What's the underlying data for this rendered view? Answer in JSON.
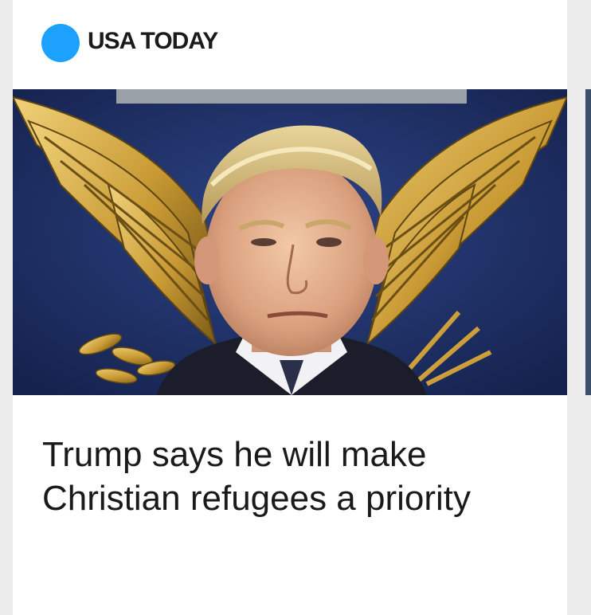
{
  "publisher": {
    "name": "USA TODAY",
    "logo_color": "#1ca1ff"
  },
  "article": {
    "image_icon": "photo-of-person-with-eagle-emblem",
    "headline": "Trump says he will make Christian refugees a priority"
  }
}
